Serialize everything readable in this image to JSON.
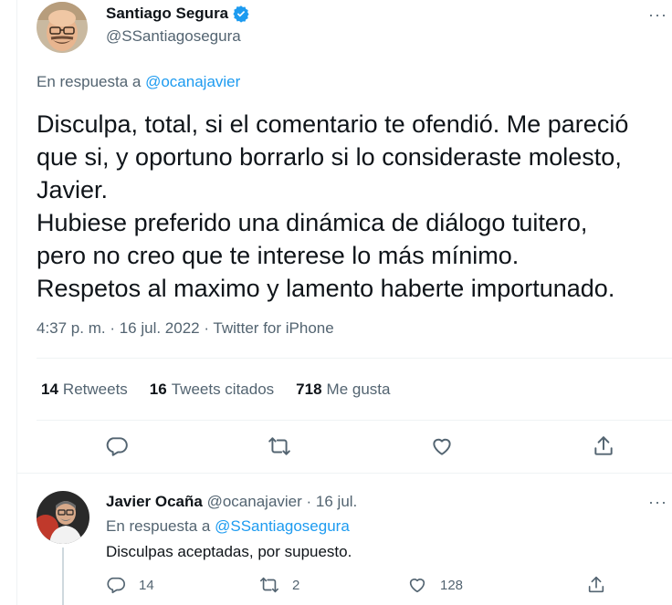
{
  "main_tweet": {
    "author_name": "Santiago Segura",
    "author_handle": "@SSantiagosegura",
    "reply_prefix": "En respuesta a",
    "reply_to": "@ocanajavier",
    "text": "Disculpa, total, si el comentario te ofendió. Me pareció\nque si, y oportuno borrarlo si lo consideraste molesto,\nJavier.\nHubiese preferido una dinámica de diálogo tuitero,\npero no creo que te interese lo más mínimo.\nRespetos al maximo y lamento haberte importunado.",
    "meta": "4:37 p. m. · 16 jul. 2022 · Twitter for iPhone",
    "stats": {
      "retweets_count": "14",
      "retweets_label": "Retweets",
      "quotes_count": "16",
      "quotes_label": "Tweets citados",
      "likes_count": "718",
      "likes_label": "Me gusta"
    }
  },
  "reply_tweet": {
    "author_name": "Javier Ocaña",
    "author_handle": "@ocanajavier",
    "date": "· 16 jul.",
    "reply_prefix": "En respuesta a",
    "reply_to": "@SSantiagosegura",
    "text": "Disculpas aceptadas, por supuesto.",
    "reply_count": "14",
    "retweet_count": "2",
    "like_count": "128"
  },
  "icons": {
    "more": "more-dots-icon",
    "verified": "verified-badge-icon",
    "reply": "reply-icon",
    "retweet": "retweet-icon",
    "like": "heart-icon",
    "share": "share-icon"
  },
  "colors": {
    "text": "#0f1419",
    "secondary": "#536471",
    "link": "#1d9bf0",
    "divider": "#eff3f4"
  }
}
